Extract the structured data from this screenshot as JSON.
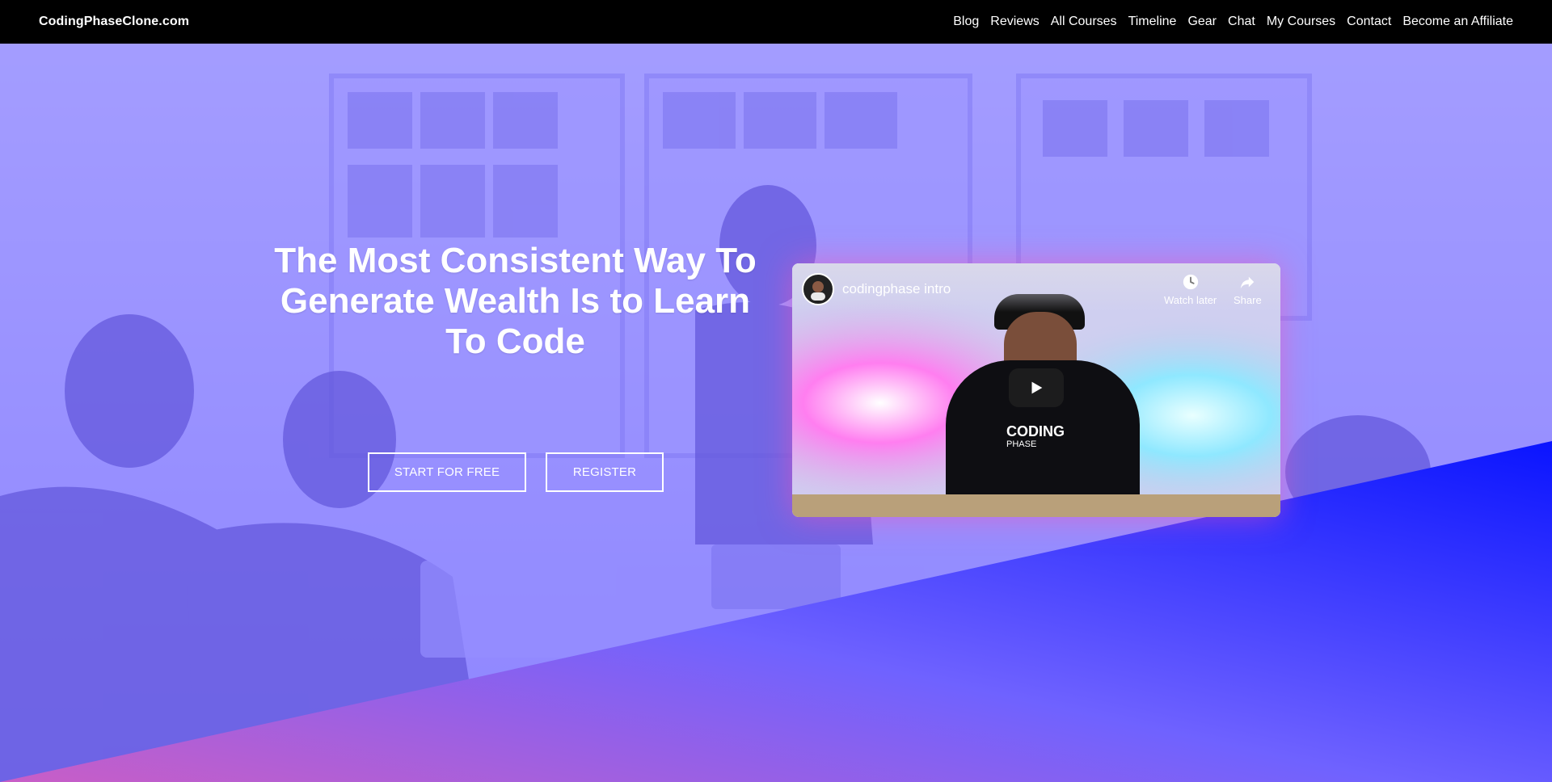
{
  "brand": "CodingPhaseClone.com",
  "nav": [
    {
      "label": "Blog"
    },
    {
      "label": "Reviews"
    },
    {
      "label": "All Courses"
    },
    {
      "label": "Timeline"
    },
    {
      "label": "Gear"
    },
    {
      "label": "Chat"
    },
    {
      "label": "My Courses"
    },
    {
      "label": "Contact"
    },
    {
      "label": "Become an Affiliate"
    }
  ],
  "hero": {
    "headline": "The Most Consistent Way To Generate Wealth Is to Learn To Code",
    "buttons": {
      "start": "Start for free",
      "register": "Register"
    }
  },
  "video": {
    "title": "codingphase intro",
    "watch_later": "Watch later",
    "share": "Share",
    "shirt_logo_main": "CODING",
    "shirt_logo_sub": "PHASE"
  },
  "colors": {
    "nav_bg": "#000000",
    "tint": "#7a6cff",
    "diag_start": "#c15dd0",
    "diag_end": "#0a18ff",
    "video_glow": "#ff50b4"
  },
  "icons": {
    "watch_later": "clock-icon",
    "share": "share-arrow-icon",
    "play": "play-icon"
  }
}
